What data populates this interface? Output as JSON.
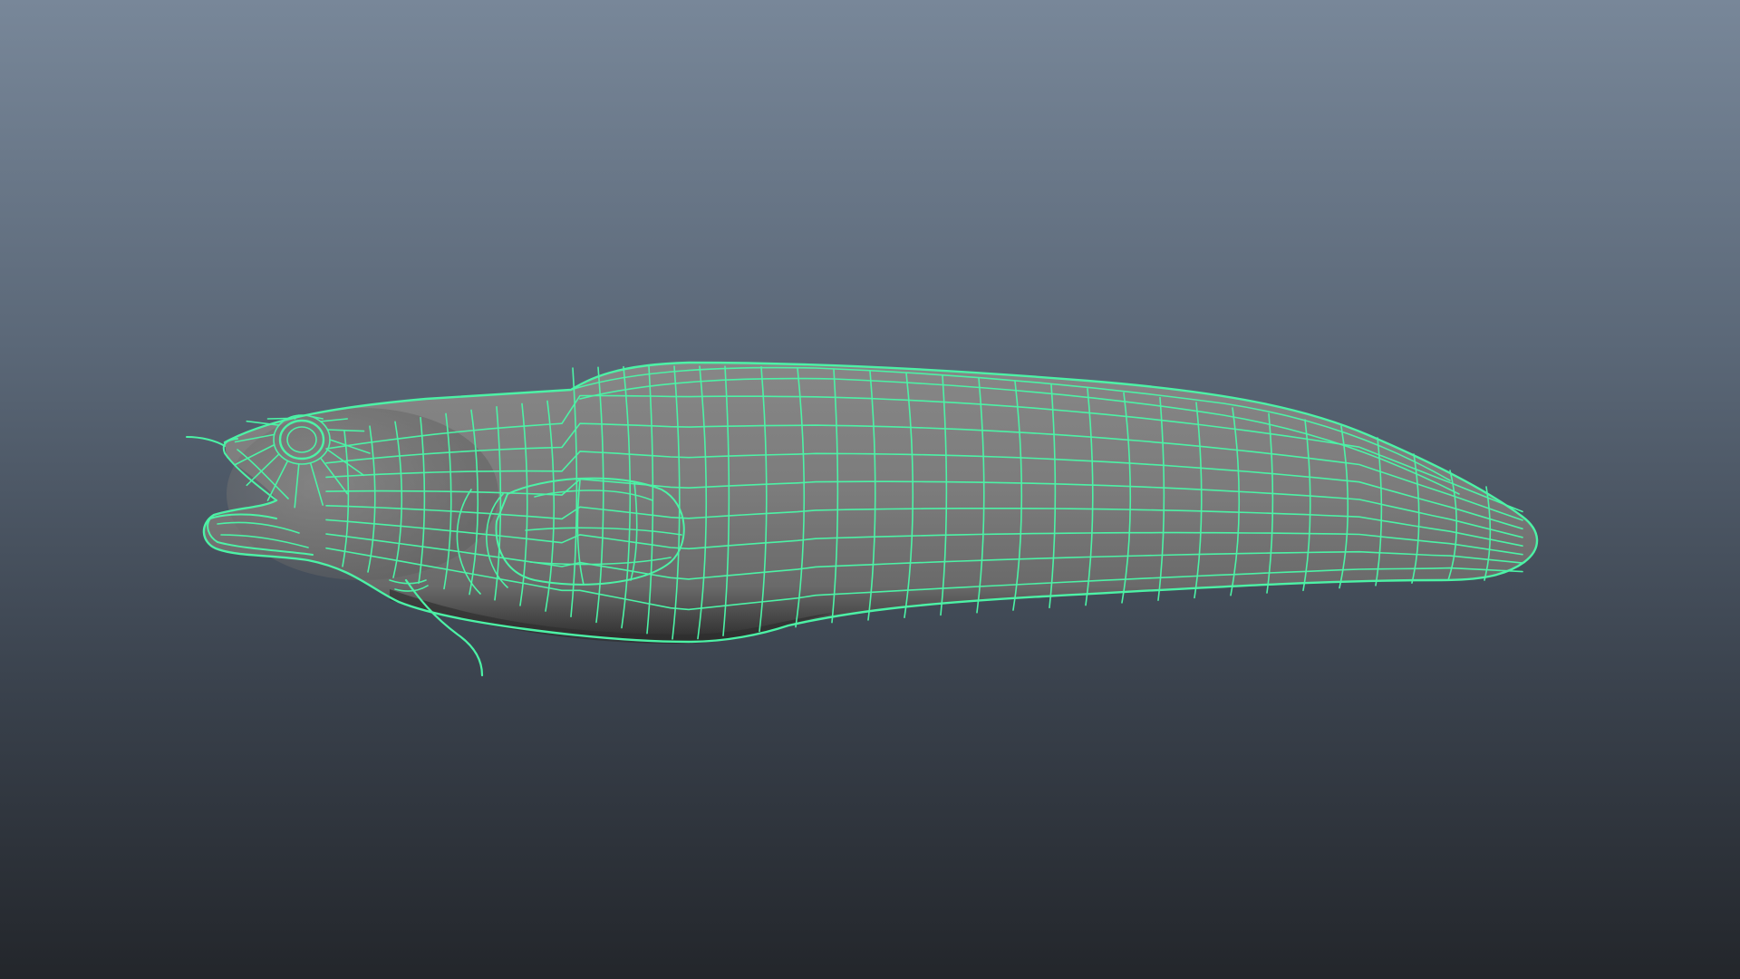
{
  "viewport": {
    "background_top": "#788799",
    "background_bottom": "#23262b"
  },
  "model": {
    "subject": "fish",
    "display_mode": "wireframe-on-shaded",
    "wire_color": "#4cf2a6",
    "surface_color": "#7a7a7a",
    "shadow_color": "#2a2a2a"
  }
}
